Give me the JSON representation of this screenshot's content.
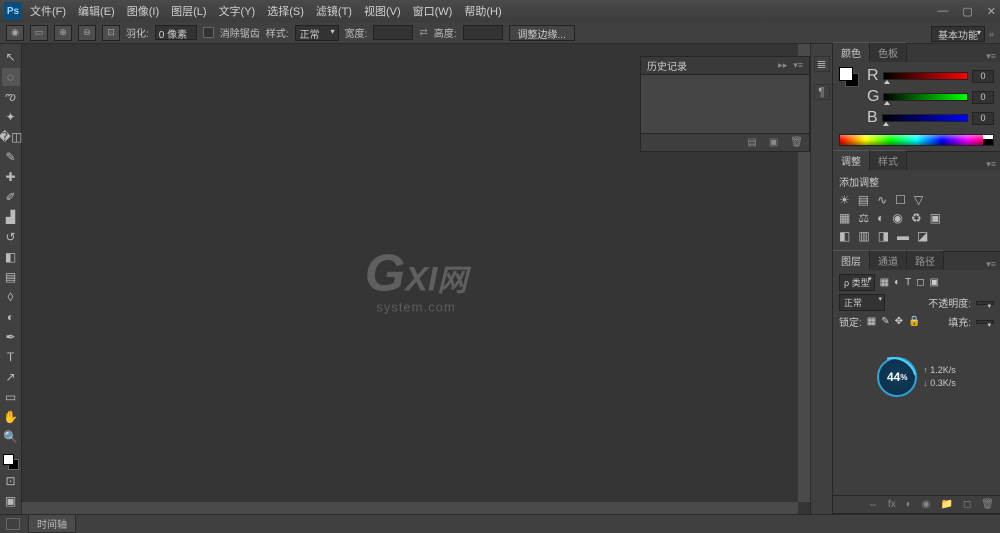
{
  "app": {
    "logo_text": "Ps"
  },
  "menu": {
    "file": "文件(F)",
    "edit": "编辑(E)",
    "image": "图像(I)",
    "layer": "图层(L)",
    "type": "文字(Y)",
    "select": "选择(S)",
    "filter": "滤镜(T)",
    "view": "视图(V)",
    "window": "窗口(W)",
    "help": "帮助(H)"
  },
  "optbar": {
    "feather_label": "羽化:",
    "feather_value": "0 像素",
    "antialias_label": "消除锯齿",
    "style_label": "样式:",
    "style_value": "正常",
    "width_label": "宽度:",
    "height_label": "高度:",
    "refine_label": "调整边缘..."
  },
  "workspace": {
    "value": "基本功能"
  },
  "history": {
    "tab": "历史记录"
  },
  "color_panel": {
    "tab1": "颜色",
    "tab2": "色板",
    "r_label": "R",
    "g_label": "G",
    "b_label": "B",
    "r_val": "0",
    "g_val": "0",
    "b_val": "0"
  },
  "adjust_panel": {
    "tab1": "调整",
    "tab2": "样式",
    "title": "添加调整"
  },
  "layers": {
    "tab1": "图层",
    "tab2": "通道",
    "tab3": "路径",
    "kind_label": "ρ 类型",
    "blend_value": "正常",
    "opacity_label": "不透明度:",
    "lock_label": "锁定:",
    "fill_label": "填充:"
  },
  "perf": {
    "pct": "44",
    "up": "1.2K/s",
    "down": "0.3K/s"
  },
  "watermark": {
    "big1": "G",
    "big2": "XI",
    "big3": "网",
    "sub": "system.com"
  },
  "statusbar": {
    "timeline": "时间轴"
  }
}
